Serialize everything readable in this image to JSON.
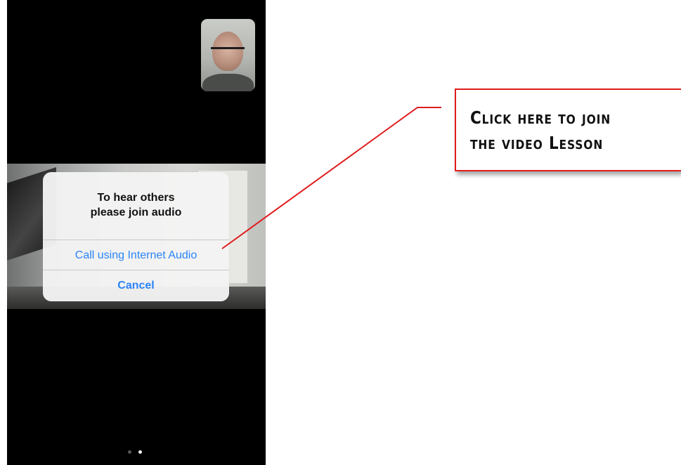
{
  "dialog": {
    "title_line1": "To hear others",
    "title_line2": "please join audio",
    "primary_button": "Call using Internet Audio",
    "cancel_button": "Cancel"
  },
  "annotation": {
    "line1": "Click here to join",
    "line2": "the video Lesson",
    "accent_color": "#e01c1c"
  },
  "pager": {
    "total_pages": 2,
    "current_page": 2
  },
  "colors": {
    "screen_background": "#000000",
    "dialog_button": "#2a84f7"
  }
}
